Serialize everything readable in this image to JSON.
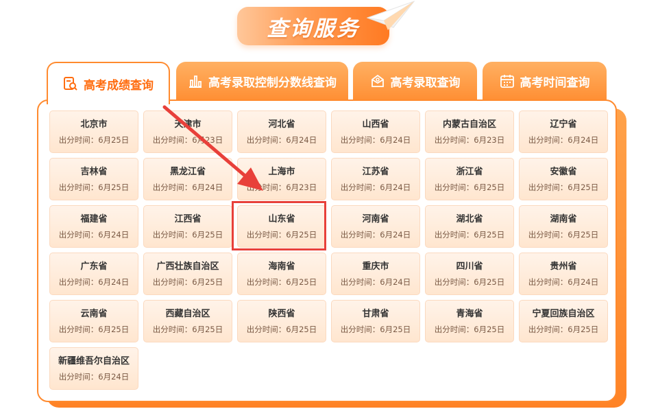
{
  "header": {
    "title": "查询服务"
  },
  "tabs": [
    {
      "label": "高考成绩查询",
      "icon": "search-doc-icon",
      "active": true
    },
    {
      "label": "高考录取控制分数线查询",
      "icon": "bar-chart-icon",
      "active": false
    },
    {
      "label": "高考录取查询",
      "icon": "envelope-icon",
      "active": false
    },
    {
      "label": "高考时间查询",
      "icon": "calendar-icon",
      "active": false
    }
  ],
  "time_prefix": "出分时间：",
  "provinces": [
    {
      "name": "北京市",
      "date": "6月25日"
    },
    {
      "name": "天津市",
      "date": "6月23日"
    },
    {
      "name": "河北省",
      "date": "6月24日"
    },
    {
      "name": "山西省",
      "date": "6月24日"
    },
    {
      "name": "内蒙古自治区",
      "date": "6月23日"
    },
    {
      "name": "辽宁省",
      "date": "6月24日"
    },
    {
      "name": "吉林省",
      "date": "6月25日"
    },
    {
      "name": "黑龙江省",
      "date": "6月24日"
    },
    {
      "name": "上海市",
      "date": "6月23日"
    },
    {
      "name": "江苏省",
      "date": "6月24日"
    },
    {
      "name": "浙江省",
      "date": "6月25日"
    },
    {
      "name": "安徽省",
      "date": "6月25日"
    },
    {
      "name": "福建省",
      "date": "6月24日"
    },
    {
      "name": "江西省",
      "date": "6月25日"
    },
    {
      "name": "山东省",
      "date": "6月25日"
    },
    {
      "name": "河南省",
      "date": "6月24日"
    },
    {
      "name": "湖北省",
      "date": "6月25日"
    },
    {
      "name": "湖南省",
      "date": "6月25日"
    },
    {
      "name": "广东省",
      "date": "6月24日"
    },
    {
      "name": "广西壮族自治区",
      "date": "6月25日"
    },
    {
      "name": "海南省",
      "date": "6月25日"
    },
    {
      "name": "重庆市",
      "date": "6月24日"
    },
    {
      "name": "四川省",
      "date": "6月25日"
    },
    {
      "name": "贵州省",
      "date": "6月24日"
    },
    {
      "name": "云南省",
      "date": "6月25日"
    },
    {
      "name": "西藏自治区",
      "date": "6月25日"
    },
    {
      "name": "陕西省",
      "date": "6月25日"
    },
    {
      "name": "甘肃省",
      "date": "6月25日"
    },
    {
      "name": "青海省",
      "date": "6月25日"
    },
    {
      "name": "宁夏回族自治区",
      "date": "6月25日"
    },
    {
      "name": "新疆维吾尔自治区",
      "date": "6月24日"
    }
  ],
  "colors": {
    "accent": "#ff8a2e",
    "annotation": "#e8403a"
  }
}
